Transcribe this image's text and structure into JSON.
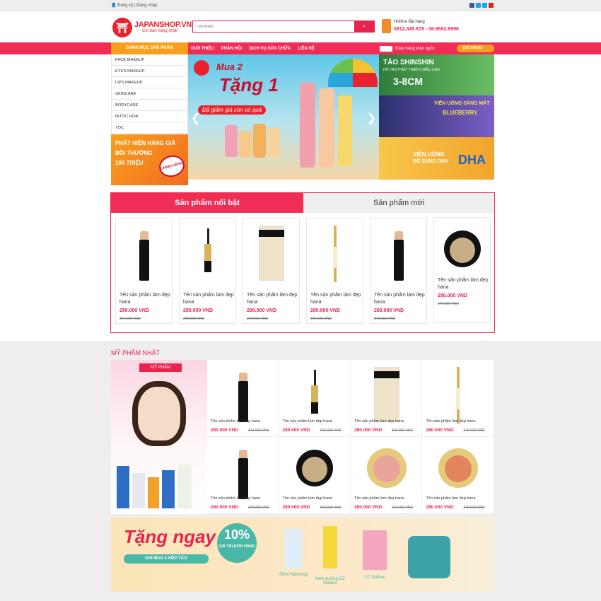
{
  "topbar": {
    "register": "Đăng ký",
    "sep": "|",
    "login": "Đăng nhập"
  },
  "logo": {
    "name": "JAPANSHOP.VN",
    "tagline": "Chỉ bán hàng Nhật",
    "glyph": "⛩"
  },
  "search": {
    "placeholder": "Tìm kiếm",
    "icon": "search-icon"
  },
  "hotline": {
    "label": "Hotline đặt hàng",
    "numbers": "0912.345.678 - 08.6692.6996"
  },
  "nav": {
    "category_title": "DANH MỤC SẢN PHẨM",
    "menu": [
      "GIỚI THIỆU",
      "PHẢN HỒI",
      "DỊCH VỤ SỬA CHỮA",
      "LIÊN HỆ"
    ],
    "shipping": "Giao hàng toàn quốc",
    "cart": "GIỎ HÀNG 🛒"
  },
  "categories": [
    "FACE MAKEUP",
    "EYES MAKEUP",
    "LIPS MAKEUP",
    "SKINCARE",
    "BODYCARE",
    "NƯỚC HOA",
    "TÓC"
  ],
  "side_banner": {
    "line1": "PHÁT HIỆN HÀNG GIẢ",
    "line2": "BỒI THƯỜNG",
    "line3": "100 TRIỆU",
    "stamp": "CHÍNH HÃNG"
  },
  "slider": {
    "title1": "Mua 2",
    "title2": "Tặng 1",
    "subtitle": "Đã giảm giá còn có quà",
    "prev": "❮",
    "next": "❯"
  },
  "promos": [
    {
      "title": "TẢO SHINSHIN",
      "sub": "HỖ TRỢ PHÁT TRIỂN CHIỀU CAO",
      "big": "3-8CM"
    },
    {
      "title": "VIÊN UỐNG SÁNG MẮT",
      "sub": "BLUEBERRY"
    },
    {
      "title": "VIÊN UỐNG",
      "sub": "BỔ SUNG DHA",
      "big": "DHA"
    }
  ],
  "tabs": {
    "active": "Sản phẩm nổi bật",
    "other": "Sản phẩm mới"
  },
  "featured_products": [
    {
      "name": "Tên sản phẩm làm đẹp hana",
      "price": "280.000 VND",
      "old": "340.000 VND",
      "kind": "stick"
    },
    {
      "name": "Tên sản phẩm làm đẹp hana",
      "price": "280.000 VND",
      "old": "340.000 VND",
      "kind": "liner"
    },
    {
      "name": "Tên sản phẩm làm đẹp hana",
      "price": "280.000 VND",
      "old": "340.000 VND",
      "kind": "bb"
    },
    {
      "name": "Tên sản phẩm làm đẹp hana",
      "price": "280.000 VND",
      "old": "340.000 VND",
      "kind": "liner2"
    },
    {
      "name": "Tên sản phẩm làm đẹp hana",
      "price": "280.000 VND",
      "old": "340.000 VND",
      "kind": "stick"
    },
    {
      "name": "Tên sản phẩm làm đẹp hana",
      "price": "280.000 VND",
      "old": "340.000 VND",
      "kind": "compact"
    }
  ],
  "section": {
    "title": "MỸ PHẨM NHẬT",
    "banner_ribbon": "MỸ PHẨM"
  },
  "grid_products": [
    {
      "name": "Tên sản phẩm làm đẹp hana",
      "price": "280.000 VND",
      "old": "340.000 VND",
      "kind": "stick"
    },
    {
      "name": "Tên sản phẩm làm đẹp hana",
      "price": "280.000 VND",
      "old": "340.000 VND",
      "kind": "liner"
    },
    {
      "name": "Tên sản phẩm làm đẹp hana",
      "price": "280.000 VND",
      "old": "340.000 VND",
      "kind": "bb"
    },
    {
      "name": "Tên sản phẩm làm đẹp hana",
      "price": "280.000 VND",
      "old": "340.000 VND",
      "kind": "liner2"
    },
    {
      "name": "Tên sản phẩm làm đẹp hana",
      "price": "280.000 VND",
      "old": "340.000 VND",
      "kind": "stick"
    },
    {
      "name": "Tên sản phẩm làm đẹp hana",
      "price": "280.000 VND",
      "old": "340.000 VND",
      "kind": "compact"
    },
    {
      "name": "Tên sản phẩm làm đẹp hana",
      "price": "280.000 VND",
      "old": "340.000 VND",
      "kind": "blush"
    },
    {
      "name": "Tên sản phẩm làm đẹp hana",
      "price": "280.000 VND",
      "old": "340.000 VND",
      "kind": "blush2"
    }
  ],
  "bottom_banner": {
    "title": "Tặng ngay",
    "cta": "KHI MUA 3 HỘP TẢO",
    "percent": "10%",
    "percent_sub": "GIÁ TRỊ ĐƠN HÀNG",
    "products": [
      "SRM Hatomugi",
      "Kem dưỡng CC Melano",
      "CC Dottree"
    ]
  },
  "colors": {
    "primary": "#f12d55",
    "accent": "#f8a01d",
    "brand_red": "#e8232f"
  }
}
